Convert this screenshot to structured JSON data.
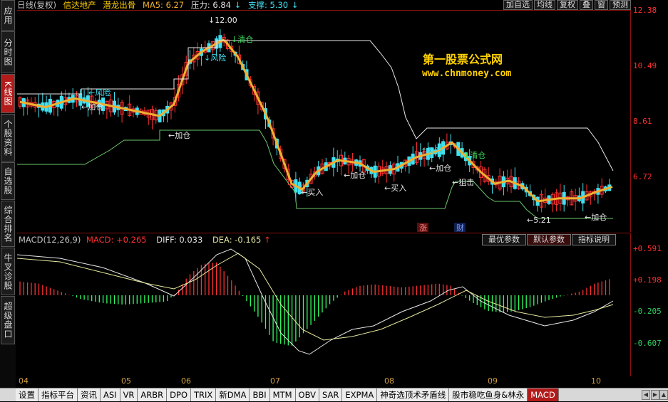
{
  "left_tabs": [
    {
      "label": "应用",
      "active": false
    },
    {
      "label": "分时图",
      "active": false
    },
    {
      "label": "K线图",
      "active": true
    },
    {
      "label": "个股资料",
      "active": false
    },
    {
      "label": "自选股",
      "active": false
    },
    {
      "label": "综合排名",
      "active": false
    },
    {
      "label": "牛叉诊股",
      "active": false
    },
    {
      "label": "超级盘口",
      "active": false
    }
  ],
  "top_info": {
    "period": "日线(复权)",
    "stock": "信达地产",
    "indicator": "潜龙出骨",
    "ma5": "MA5: 6.27",
    "pressure": "压力: 6.84",
    "support": "支撑: 5.30"
  },
  "top_buttons": [
    "加自选",
    "均线",
    "复权",
    "叠",
    "窗",
    "预测"
  ],
  "colors": {
    "up": "#ff3030",
    "down": "#40e0f0",
    "ma": "#f0b030",
    "line": "#e0e0e0",
    "support": "#80d080",
    "neg": "#30ff60",
    "axis": "#ff3030"
  },
  "price_axis": [
    "12.38",
    "10.49",
    "8.61",
    "6.72"
  ],
  "macd_axis": [
    "+0.591",
    "+0.198",
    "-0.205",
    "-0.607"
  ],
  "watermark": {
    "line1": "第一股票公式网",
    "line2": "www.chnmoney.com"
  },
  "annotations": {
    "high": "12.00",
    "low": "5.21",
    "qingcang": "清仓",
    "fengxian": "风险",
    "jiacang": "加仓",
    "mairu": "买入",
    "jieshi": "狙击",
    "zhang": "涨",
    "cai": "财"
  },
  "macd": {
    "title": "MACD(12,26,9)",
    "macd_label": "MACD:",
    "macd_value": "+0.265",
    "dif": "DIFF: 0.033",
    "dea": "DEA: -0.165"
  },
  "macd_buttons": [
    "最优参数",
    "默认参数",
    "指标说明"
  ],
  "months": [
    "04",
    "05",
    "06",
    "07",
    "08",
    "09",
    "10"
  ],
  "bottom_tabs": [
    "设置",
    "指标平台",
    "资讯",
    "ASI",
    "VR",
    "ARBR",
    "DPO",
    "TRIX",
    "新DMA",
    "BBI",
    "MTM",
    "OBV",
    "SAR",
    "EXPMA",
    "神奇选顶术矛盾线",
    "股市稳吃鱼身&林永",
    "MACD"
  ]
}
